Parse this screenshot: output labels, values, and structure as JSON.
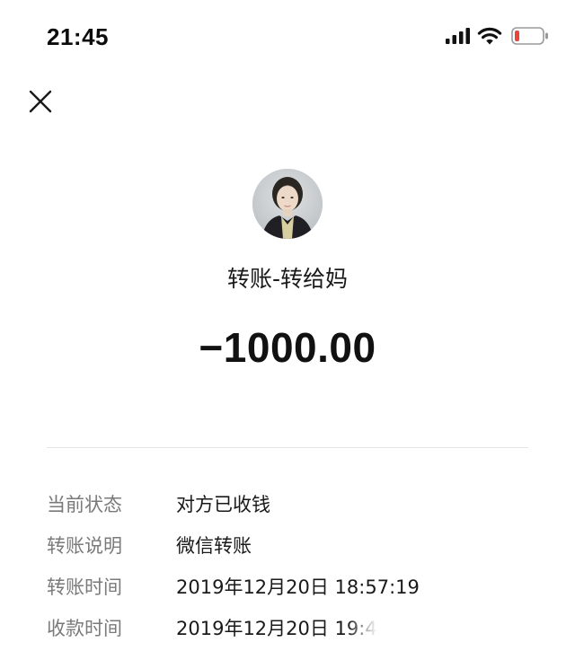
{
  "status_bar": {
    "time": "21:45",
    "icons": [
      "signal-icon",
      "wifi-icon",
      "battery-low-icon"
    ],
    "battery_color": "#e5473d"
  },
  "header": {
    "close_icon": "close-icon"
  },
  "transfer": {
    "title": "转账-转给妈",
    "amount": "−1000.00"
  },
  "details": [
    {
      "label": "当前状态",
      "value": "对方已收钱"
    },
    {
      "label": "转账说明",
      "value": "微信转账"
    },
    {
      "label": "转账时间",
      "value": "2019年12月20日 18:57:19"
    },
    {
      "label": "收款时间",
      "value": "2019年12月20日 19:4"
    }
  ]
}
